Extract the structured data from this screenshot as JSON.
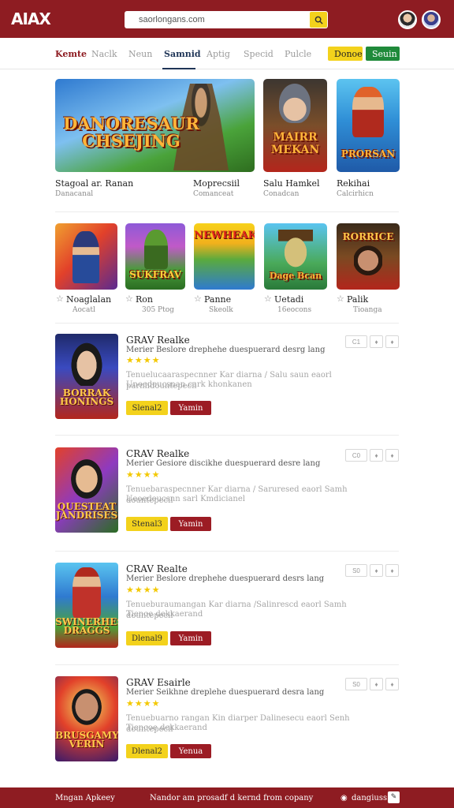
{
  "header": {
    "logo": "AIAX",
    "search_value": "saorlongans.com"
  },
  "nav": {
    "tabs": [
      "Kemte",
      "Naclk",
      "Neun",
      "Samnid",
      "Aptig",
      "Specid",
      "Pulcle"
    ],
    "btn_primary": "Donoe",
    "btn_secondary": "Seuin"
  },
  "featured": [
    {
      "art": "DANORESAUR CHSEJING",
      "title": "Stagoal ar. Ranan",
      "sub": "Danacanal"
    },
    {
      "art": "MAIRR MEKAN",
      "title": "Moprecsiil",
      "sub": "Comanceat"
    },
    {
      "art": "PRORSAN",
      "title": "Salu Hamkel",
      "sub": "Conadcan"
    },
    {
      "art": "",
      "title": "Rekihai",
      "sub": "Calcirhicn"
    }
  ],
  "row2": [
    {
      "art": "",
      "title": "Noaglalan",
      "sub": "Aocatl"
    },
    {
      "art": "SUKFRAV",
      "title": "Ron",
      "sub": "305 Ptog"
    },
    {
      "art": "NEWHEAK",
      "title": "Panne",
      "sub": "Skeolk"
    },
    {
      "art": "Dage Bcan",
      "title": "Uetadi",
      "sub": "16eocons"
    },
    {
      "art": "RORRICE",
      "title": "Palik",
      "sub": "Tioanga"
    }
  ],
  "list": [
    {
      "art": "BORRAK HONINGS",
      "title": "GRAV Realke",
      "sub": "Merier Beslore drephehe duespuerard desrg lang",
      "stars": "★★★★",
      "desc1": "Tenuelucaaraspecnner Kar diarna / Salu saun eaorl parnlidountepecil",
      "desc2": "Unoedeucsnan cark khonkanen",
      "btn1": "Slenal2",
      "btn2": "Yamin",
      "m1": "C1"
    },
    {
      "art": "QUESTEAT JANDRISES",
      "title": "CRAV Realke",
      "sub": "Merier Gesiore discikhe duespuerard desre lang",
      "stars": "★★★★",
      "desc1": "Tenuebaraspecnner Kar diarna / Saruresed eaorl Samh dountepecil",
      "desc2": "Ueoedeucsnn sarl Kmdicianel",
      "btn1": "Stenal3",
      "btn2": "Yamin",
      "m1": "C0"
    },
    {
      "art": "SWINERHES DRAGGS",
      "title": "CRAV Realte",
      "sub": "Merier Beslore drephehe duespuerard desrs lang",
      "stars": "★★★★",
      "desc1": "Tenueburaumangan Kar diarna /Salinrescd eaorl Samh dountepecil",
      "desc2": "Tienoe dekkaerand",
      "btn1": "Dlenal9",
      "btn2": "Yamin",
      "m1": "S0"
    },
    {
      "art": "BRUSGAMY VERIN",
      "title": "GRAV Esairle",
      "sub": "Merier Seikhne dreplehe duespuerard desra lang",
      "stars": "★★★★",
      "desc1": "Tenuebuarno rangan Kin diarper Dalinesecu eaorl Senh dountepecil",
      "desc2": "Tiencoe dekkaerand",
      "btn1": "Dlenal2",
      "btn2": "Yenua",
      "m1": "S0"
    }
  ],
  "footer": {
    "left": "Mngan Apkeey",
    "center": "Nandor am prosadf d kernd from copany",
    "right": "dangiuss"
  }
}
